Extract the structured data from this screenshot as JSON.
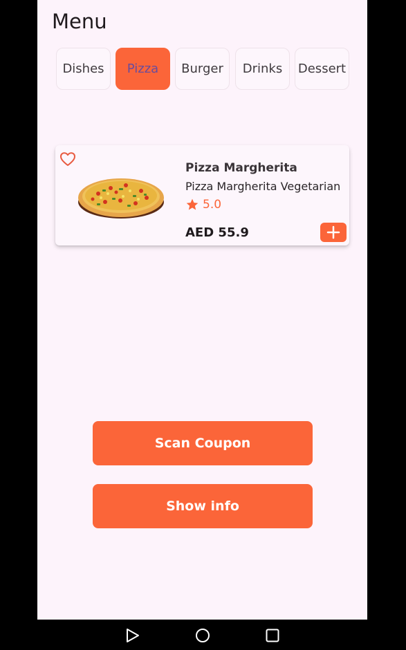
{
  "header": {
    "title": "Menu"
  },
  "tabs": [
    {
      "label": "Dishes",
      "active": false
    },
    {
      "label": "Pizza",
      "active": true
    },
    {
      "label": "Burger",
      "active": false
    },
    {
      "label": "Drinks",
      "active": false
    },
    {
      "label": "Dessert",
      "active": false
    }
  ],
  "product": {
    "name": "Pizza Margherita",
    "description": "Pizza Margherita Vegetarian",
    "rating": "5.0",
    "price": "AED 55.9",
    "image_icon": "pizza-image",
    "favorite_icon": "heart-outline-icon",
    "add_icon": "plus-icon"
  },
  "actions": {
    "scan_label": "Scan Coupon",
    "info_label": "Show info"
  },
  "system_nav": {
    "back_icon": "triangle-back-icon",
    "home_icon": "circle-home-icon",
    "recents_icon": "square-recents-icon"
  },
  "colors": {
    "accent": "#fb6539",
    "background": "#fdf3fb",
    "active_tab_text": "#6a4c9c"
  }
}
